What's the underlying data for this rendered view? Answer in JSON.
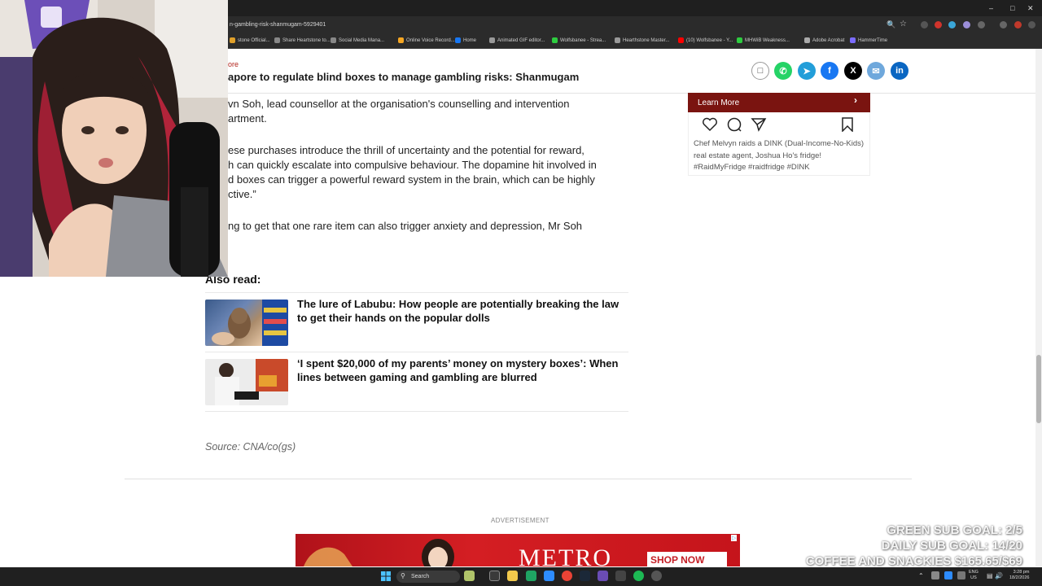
{
  "browser": {
    "url": "n-gambling-risk-shanmugam-5929401",
    "bookmarks": [
      {
        "label": "stone Official...",
        "color": "#e0a02a"
      },
      {
        "label": "Share Heartstone to...",
        "color": "#888888"
      },
      {
        "label": "Social Media Mana...",
        "color": "#888888"
      },
      {
        "label": "Online Voice Record...",
        "color": "#f5a623"
      },
      {
        "label": "Home",
        "color": "#1877f2"
      },
      {
        "label": "Animated GIF editor...",
        "color": "#999999"
      },
      {
        "label": "Wolfsbanee - Strea...",
        "color": "#2ecc40"
      },
      {
        "label": "Hearthstone Master...",
        "color": "#999999"
      },
      {
        "label": "(10) Wolfsbanee - Y...",
        "color": "#ff0000"
      },
      {
        "label": "MHWiB Weakness...",
        "color": "#2ecc40"
      },
      {
        "label": "Adobe Acrobat",
        "color": "#aaaaaa"
      },
      {
        "label": "HammerTime",
        "color": "#7b6cff"
      }
    ]
  },
  "article": {
    "kicker": "ore",
    "headline": "apore to regulate blind boxes to manage gambling risks: Shanmugam",
    "para1": [
      "vn Soh, lead counsellor at the organisation's counselling and intervention",
      "artment."
    ],
    "para2": [
      "ese purchases introduce the thrill of uncertainty and the potential for reward,",
      "h can quickly escalate into compulsive behaviour. The dopamine hit involved in",
      "d boxes can trigger a powerful reward system in the brain, which can be highly",
      "ctive.”"
    ],
    "para3": [
      "ng to get that one rare item can also trigger anxiety and depression, Mr Soh"
    ],
    "also_read_heading": "Also read:",
    "also_read": [
      {
        "title": "The lure of Labubu: How people are potentially breaking the law to get their hands on the popular dolls"
      },
      {
        "title": "‘I spent $20,000 of my parents’ money on mystery boxes’: When lines between gaming and gambling are blurred"
      }
    ],
    "source": "Source: CNA/co(gs)",
    "ad_label": "ADVERTISEMENT",
    "ad_text": "METRO",
    "ad_cta": "SHOP NOW"
  },
  "share_buttons": [
    {
      "name": "bookmark",
      "color": "#ffffff"
    },
    {
      "name": "whatsapp",
      "color": "#25d366"
    },
    {
      "name": "telegram",
      "color": "#229ed9"
    },
    {
      "name": "facebook",
      "color": "#1877f2"
    },
    {
      "name": "x",
      "color": "#000000"
    },
    {
      "name": "email",
      "color": "#6fa8dc"
    },
    {
      "name": "linkedin",
      "color": "#0a66c2"
    }
  ],
  "sidebar": {
    "learn_more": "Learn More",
    "caption": "Chef Melvyn raids a DINK (Dual-Income-No-Kids) real estate agent, Joshua Ho's fridge! #RaidMyFridge #raidfridge #DINK"
  },
  "overlay": {
    "line1": "GREEN SUB GOAL: 2/5",
    "line2": "DAILY SUB GOAL: 14/20",
    "line3": "COFFEE AND SNACKIES $165.65/$69"
  },
  "taskbar": {
    "search": "Search",
    "lang": "ENG\nUS",
    "time": "3:28 pm",
    "date": "18/2/2026"
  }
}
